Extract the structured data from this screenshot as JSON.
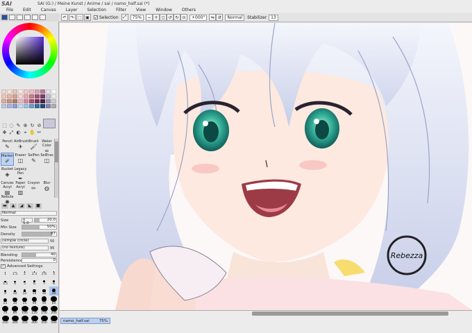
{
  "window": {
    "logo": "SAI",
    "title": "SAI (G:) / Meine Kunst / Anime / sai / namo_half.sai (*)"
  },
  "menu": [
    "File",
    "Edit",
    "Canvas",
    "Layer",
    "Selection",
    "Filter",
    "View",
    "Window",
    "Others"
  ],
  "toolbar": {
    "selection_label": "Selection",
    "zoom": "75%",
    "rotation": "+000°",
    "blend_mode": "Normal",
    "stabilizer_label": "Stabilizer",
    "stabilizer_value": "13"
  },
  "colors": {
    "current": "#ccc6dc",
    "swatches": [
      "#f3d9cd",
      "#f7e3dc",
      "#e8c8bd",
      "#fbe8e4",
      "#f5c9c9",
      "#eec0c8",
      "#d9a7b6",
      "#b97f9a",
      "#e8e2ea",
      "#fbfbfb",
      "#f0cbb8",
      "#e7b9a9",
      "#d9a391",
      "#f9d6d4",
      "#eaa9b1",
      "#c97b8f",
      "#a6547a",
      "#7e3d6c",
      "#c6bfd3",
      "#eeeeee",
      "#d8b0a2",
      "#c99384",
      "#b07b6e",
      "#e8bcc6",
      "#d48aa1",
      "#a9506f",
      "#762f5a",
      "#4f2048",
      "#a29bb7",
      "#cfcfcf",
      "#bfc8e6",
      "#a7b6e0",
      "#8aa0d2",
      "#c7d9ee",
      "#9fc1e2",
      "#6e9ec9",
      "#3b6ea3",
      "#1f4a7c",
      "#8a86a8",
      "#b0b0b0"
    ]
  },
  "tools": {
    "selection_icons": [
      "⬚",
      "◌",
      "✎",
      "⊕",
      "↻",
      "⊘",
      "✥",
      "⤢",
      "◐",
      "⌖",
      "✋",
      "✂"
    ],
    "brushes": [
      {
        "label": "Pencil",
        "glyph": "✎"
      },
      {
        "label": "AirBrush",
        "glyph": "✈"
      },
      {
        "label": "Brush",
        "glyph": "🖌"
      },
      {
        "label": "Water Color",
        "glyph": "≈"
      },
      {
        "label": "Marker",
        "glyph": "✐"
      },
      {
        "label": "Eraser",
        "glyph": "◫"
      },
      {
        "label": "SelPen",
        "glyph": "✎"
      },
      {
        "label": "SelEras",
        "glyph": "◫"
      },
      {
        "label": "Bucket",
        "glyph": "◈"
      },
      {
        "label": "Legacy Pen",
        "glyph": "✒"
      },
      {
        "label": "",
        "glyph": ""
      },
      {
        "label": "",
        "glyph": ""
      },
      {
        "label": "Canvas Acryl",
        "glyph": "▤"
      },
      {
        "label": "Paper Acryl",
        "glyph": "▥"
      },
      {
        "label": "Crayon",
        "glyph": "✏"
      },
      {
        "label": "Blur",
        "glyph": "◍"
      },
      {
        "label": "Nebula",
        "glyph": "✺"
      }
    ]
  },
  "brush_props": {
    "blend": "Normal",
    "size_label": "Size",
    "size_mult": "x 5.0",
    "size_value": "20.0",
    "min_size_label": "Min Size",
    "min_size_value": "50%",
    "density_label": "Density",
    "density_value": "87",
    "shape": "(simple circle)",
    "shape_value": "50",
    "texture": "(no texture)",
    "texture_value": "95",
    "blending_label": "Blending",
    "blending_value": "40",
    "persistence_label": "Persistence",
    "persistence_value": "0",
    "advanced_label": "Advanced Settings"
  },
  "brush_sizes": [
    "1",
    "1.5",
    "2",
    "2.3",
    "2.6",
    "3",
    "3.5",
    "4",
    "5",
    "6",
    "7",
    "8",
    "9",
    "10",
    "12",
    "14",
    "16",
    "20",
    "25",
    "30",
    "35",
    "40",
    "50",
    "60",
    "70",
    "80",
    "100",
    "120",
    "150",
    "200",
    "250",
    "300",
    "350",
    "400",
    "450",
    "500"
  ],
  "canvas": {
    "watermark": "Rebezza"
  },
  "statusbar": {
    "doc_name": "namo_half.sai",
    "doc_zoom": "75%"
  }
}
